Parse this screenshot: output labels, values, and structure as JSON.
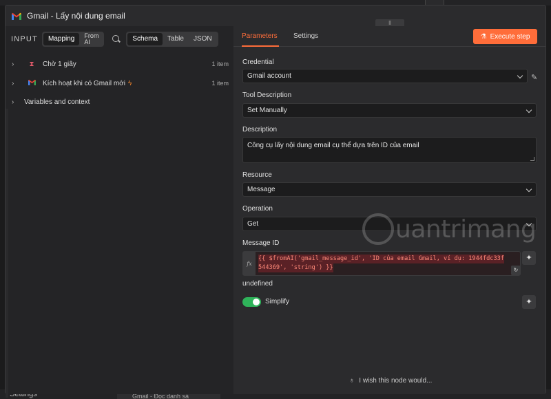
{
  "background": {
    "settings_label": "Settings",
    "bg_tab_label": "Gmail - Đọc danh sá"
  },
  "window": {
    "title": "Gmail - Lấy nội dung email"
  },
  "input_panel": {
    "label": "INPUT",
    "mode_options": [
      "Mapping",
      "From AI"
    ],
    "mode_selected": "Mapping",
    "view_options": [
      "Schema",
      "Table",
      "JSON"
    ],
    "view_selected": "Schema",
    "tree": [
      {
        "label": "Chờ 1 giây",
        "count": "1 item",
        "icon": "hourglass-icon"
      },
      {
        "label": "Kích hoạt khi có Gmail mới",
        "count": "1 item",
        "icon": "gmail-icon",
        "badge": "bolt-icon"
      },
      {
        "label": "Variables and context",
        "count": "",
        "icon": ""
      }
    ]
  },
  "parameters": {
    "tabs": [
      "Parameters",
      "Settings"
    ],
    "active_tab": "Parameters",
    "execute_label": "Execute step",
    "credential": {
      "label": "Credential",
      "value": "Gmail account"
    },
    "tool_description": {
      "label": "Tool Description",
      "value": "Set Manually"
    },
    "description": {
      "label": "Description",
      "value": "Công cụ lấy nội dung email cụ thể dựa trên ID của email"
    },
    "resource": {
      "label": "Resource",
      "value": "Message"
    },
    "operation": {
      "label": "Operation",
      "value": "Get"
    },
    "message_id": {
      "label": "Message ID",
      "fx_label": "fx",
      "expression_line1": "{{ $fromAI('gmail_message_id', 'ID của email Gmail, ví dụ: 1944fdc33f",
      "expression_line2": "544369', 'string') }}",
      "result": "undefined"
    },
    "simplify": {
      "label": "Simplify",
      "enabled": true
    },
    "wish_text": "I wish this node would..."
  },
  "watermark": {
    "text": "uantrimang"
  },
  "colors": {
    "accent": "#ff6d3a",
    "toggle_on": "#2fb35a",
    "expression_text": "#ff8a7a"
  }
}
